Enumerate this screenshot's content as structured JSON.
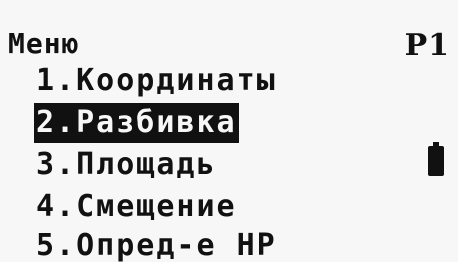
{
  "screen": {
    "title": "Меню",
    "page": "P1"
  },
  "menu": {
    "items": [
      {
        "label": "1.Координаты",
        "selected": false
      },
      {
        "label": "2.Разбивка",
        "selected": true
      },
      {
        "label": "3.Площадь",
        "selected": false
      },
      {
        "label": "4.Смещение",
        "selected": false
      },
      {
        "label": "5.Опред-е НР",
        "selected": false
      }
    ]
  },
  "status": {
    "battery_icon": "battery-icon",
    "battery_level": 1.0
  }
}
